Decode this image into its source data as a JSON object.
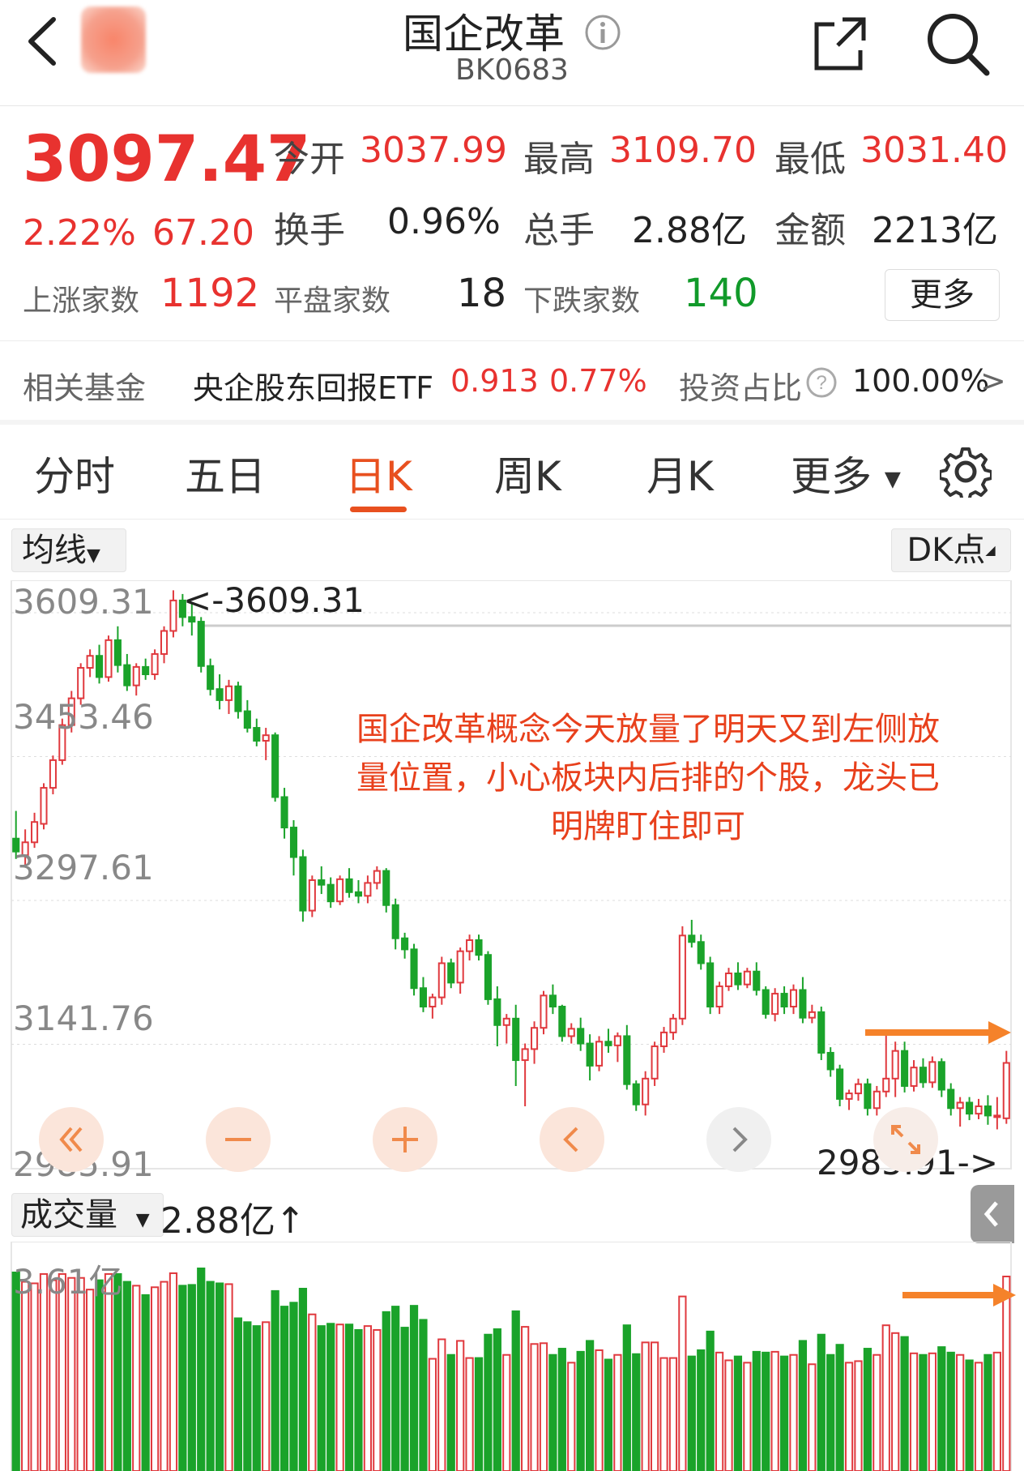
{
  "header": {
    "title": "国企改革",
    "code": "BK0683"
  },
  "quote": {
    "price": "3097.47",
    "change_pct": "2.22%",
    "change_abs": "67.20",
    "open_label": "今开",
    "open": "3037.99",
    "high_label": "最高",
    "high": "3109.70",
    "low_label": "最低",
    "low": "3031.40",
    "turnover_label": "换手",
    "turnover": "0.96%",
    "volume_label": "总手",
    "volume": "2.88亿",
    "amount_label": "金额",
    "amount": "2213亿",
    "up_label": "上涨家数",
    "up": "1192",
    "flat_label": "平盘家数",
    "flat": "18",
    "down_label": "下跌家数",
    "down": "140",
    "more_label": "更多"
  },
  "fund": {
    "label": "相关基金",
    "name": "央企股东回报ETF",
    "price": "0.913",
    "change": "0.77%",
    "ratio_label": "投资占比",
    "ratio": "100.00%",
    "arrow": ">"
  },
  "tabs": [
    "分时",
    "五日",
    "日K",
    "周K",
    "月K",
    "更多"
  ],
  "active_tab": 2,
  "chart": {
    "ma_label": "均线",
    "dk_label": "DK点",
    "high_marker": "<-3609.31",
    "low_marker": "2985.91->",
    "annotation": "国企改革概念今天放量了明天又到左侧放量位置，小心板块内后排的个股，龙头已明牌盯住即可",
    "volume_label": "成交量",
    "volume_value": "2.88亿",
    "volume_arrow": "↑",
    "volume_max_label": "3.61亿",
    "colors": {
      "up": "#e0393e",
      "down": "#1aa32a",
      "accent": "#f5822a"
    }
  },
  "chart_data": {
    "type": "candlestick",
    "y_ticks": [
      "3609.31",
      "3453.46",
      "3297.61",
      "3141.76",
      "2985.91"
    ],
    "ylim": [
      2985.91,
      3609.31
    ],
    "candles_approx": [
      [
        3340,
        3370,
        3318,
        3326
      ],
      [
        3322,
        3350,
        3310,
        3336
      ],
      [
        3336,
        3368,
        3330,
        3358
      ],
      [
        3356,
        3400,
        3350,
        3395
      ],
      [
        3395,
        3430,
        3388,
        3425
      ],
      [
        3425,
        3470,
        3420,
        3463
      ],
      [
        3463,
        3500,
        3455,
        3492
      ],
      [
        3492,
        3530,
        3485,
        3525
      ],
      [
        3525,
        3545,
        3515,
        3538
      ],
      [
        3538,
        3550,
        3508,
        3515
      ],
      [
        3515,
        3560,
        3510,
        3555
      ],
      [
        3555,
        3570,
        3520,
        3528
      ],
      [
        3528,
        3540,
        3500,
        3506
      ],
      [
        3506,
        3530,
        3495,
        3526
      ],
      [
        3526,
        3535,
        3512,
        3518
      ],
      [
        3518,
        3545,
        3512,
        3540
      ],
      [
        3540,
        3570,
        3530,
        3565
      ],
      [
        3565,
        3609,
        3558,
        3598
      ],
      [
        3598,
        3605,
        3570,
        3580
      ],
      [
        3580,
        3596,
        3560,
        3575
      ],
      [
        3575,
        3580,
        3520,
        3527
      ],
      [
        3527,
        3535,
        3495,
        3502
      ],
      [
        3502,
        3518,
        3480,
        3490
      ],
      [
        3490,
        3512,
        3475,
        3505
      ],
      [
        3505,
        3510,
        3470,
        3478
      ],
      [
        3478,
        3490,
        3455,
        3460
      ],
      [
        3460,
        3470,
        3440,
        3446
      ],
      [
        3446,
        3460,
        3425,
        3452
      ],
      [
        3452,
        3455,
        3380,
        3385
      ],
      [
        3385,
        3395,
        3340,
        3352
      ],
      [
        3352,
        3360,
        3300,
        3320
      ],
      [
        3320,
        3328,
        3250,
        3262
      ],
      [
        3262,
        3300,
        3255,
        3295
      ],
      [
        3295,
        3310,
        3280,
        3290
      ],
      [
        3290,
        3298,
        3265,
        3272
      ],
      [
        3272,
        3300,
        3268,
        3296
      ],
      [
        3296,
        3308,
        3276,
        3282
      ],
      [
        3282,
        3295,
        3270,
        3278
      ],
      [
        3278,
        3300,
        3270,
        3292
      ],
      [
        3292,
        3310,
        3285,
        3305
      ],
      [
        3305,
        3308,
        3260,
        3268
      ],
      [
        3268,
        3275,
        3220,
        3232
      ],
      [
        3232,
        3238,
        3210,
        3220
      ],
      [
        3220,
        3226,
        3170,
        3178
      ],
      [
        3178,
        3190,
        3152,
        3158
      ],
      [
        3158,
        3172,
        3145,
        3168
      ],
      [
        3168,
        3212,
        3160,
        3205
      ],
      [
        3205,
        3210,
        3178,
        3184
      ],
      [
        3184,
        3222,
        3172,
        3218
      ],
      [
        3218,
        3236,
        3208,
        3230
      ],
      [
        3230,
        3236,
        3208,
        3214
      ],
      [
        3214,
        3218,
        3160,
        3166
      ],
      [
        3166,
        3180,
        3115,
        3138
      ],
      [
        3138,
        3150,
        3118,
        3145
      ],
      [
        3145,
        3160,
        3072,
        3100
      ],
      [
        3100,
        3118,
        3050,
        3112
      ],
      [
        3112,
        3142,
        3096,
        3135
      ],
      [
        3135,
        3175,
        3128,
        3170
      ],
      [
        3170,
        3182,
        3150,
        3158
      ],
      [
        3158,
        3160,
        3120,
        3126
      ],
      [
        3126,
        3140,
        3118,
        3134
      ],
      [
        3134,
        3146,
        3110,
        3118
      ],
      [
        3118,
        3128,
        3078,
        3094
      ],
      [
        3094,
        3126,
        3088,
        3120
      ],
      [
        3120,
        3134,
        3108,
        3116
      ],
      [
        3116,
        3130,
        3098,
        3126
      ],
      [
        3126,
        3138,
        3068,
        3074
      ],
      [
        3074,
        3078,
        3045,
        3052
      ],
      [
        3052,
        3088,
        3040,
        3080
      ],
      [
        3080,
        3120,
        3072,
        3115
      ],
      [
        3115,
        3136,
        3108,
        3130
      ],
      [
        3130,
        3150,
        3122,
        3145
      ],
      [
        3145,
        3245,
        3138,
        3235
      ],
      [
        3235,
        3252,
        3222,
        3228
      ],
      [
        3228,
        3236,
        3198,
        3205
      ],
      [
        3205,
        3212,
        3150,
        3158
      ],
      [
        3158,
        3185,
        3150,
        3180
      ],
      [
        3180,
        3200,
        3175,
        3194
      ],
      [
        3194,
        3206,
        3176,
        3182
      ],
      [
        3182,
        3200,
        3178,
        3196
      ],
      [
        3196,
        3206,
        3170,
        3176
      ],
      [
        3176,
        3180,
        3145,
        3150
      ],
      [
        3150,
        3178,
        3142,
        3172
      ],
      [
        3172,
        3180,
        3150,
        3158
      ],
      [
        3158,
        3182,
        3150,
        3176
      ],
      [
        3176,
        3190,
        3140,
        3146
      ],
      [
        3146,
        3160,
        3140,
        3152
      ],
      [
        3152,
        3158,
        3100,
        3108
      ],
      [
        3108,
        3114,
        3082,
        3090
      ],
      [
        3090,
        3095,
        3050,
        3058
      ],
      [
        3058,
        3068,
        3046,
        3064
      ],
      [
        3064,
        3080,
        3056,
        3074
      ],
      [
        3074,
        3080,
        3040,
        3048
      ],
      [
        3048,
        3072,
        3040,
        3066
      ],
      [
        3066,
        3130,
        3060,
        3080
      ],
      [
        3080,
        3120,
        3060,
        3110
      ],
      [
        3110,
        3120,
        3065,
        3072
      ],
      [
        3072,
        3100,
        3066,
        3092
      ],
      [
        3092,
        3102,
        3070,
        3076
      ],
      [
        3076,
        3104,
        3070,
        3098
      ],
      [
        3098,
        3102,
        3060,
        3068
      ],
      [
        3068,
        3075,
        3040,
        3048
      ],
      [
        3048,
        3060,
        3028,
        3054
      ],
      [
        3054,
        3060,
        3035,
        3042
      ],
      [
        3042,
        3058,
        3036,
        3050
      ],
      [
        3050,
        3062,
        3030,
        3040
      ],
      [
        3040,
        3060,
        3025,
        3040
      ],
      [
        3037,
        3110,
        3031,
        3097
      ]
    ]
  }
}
